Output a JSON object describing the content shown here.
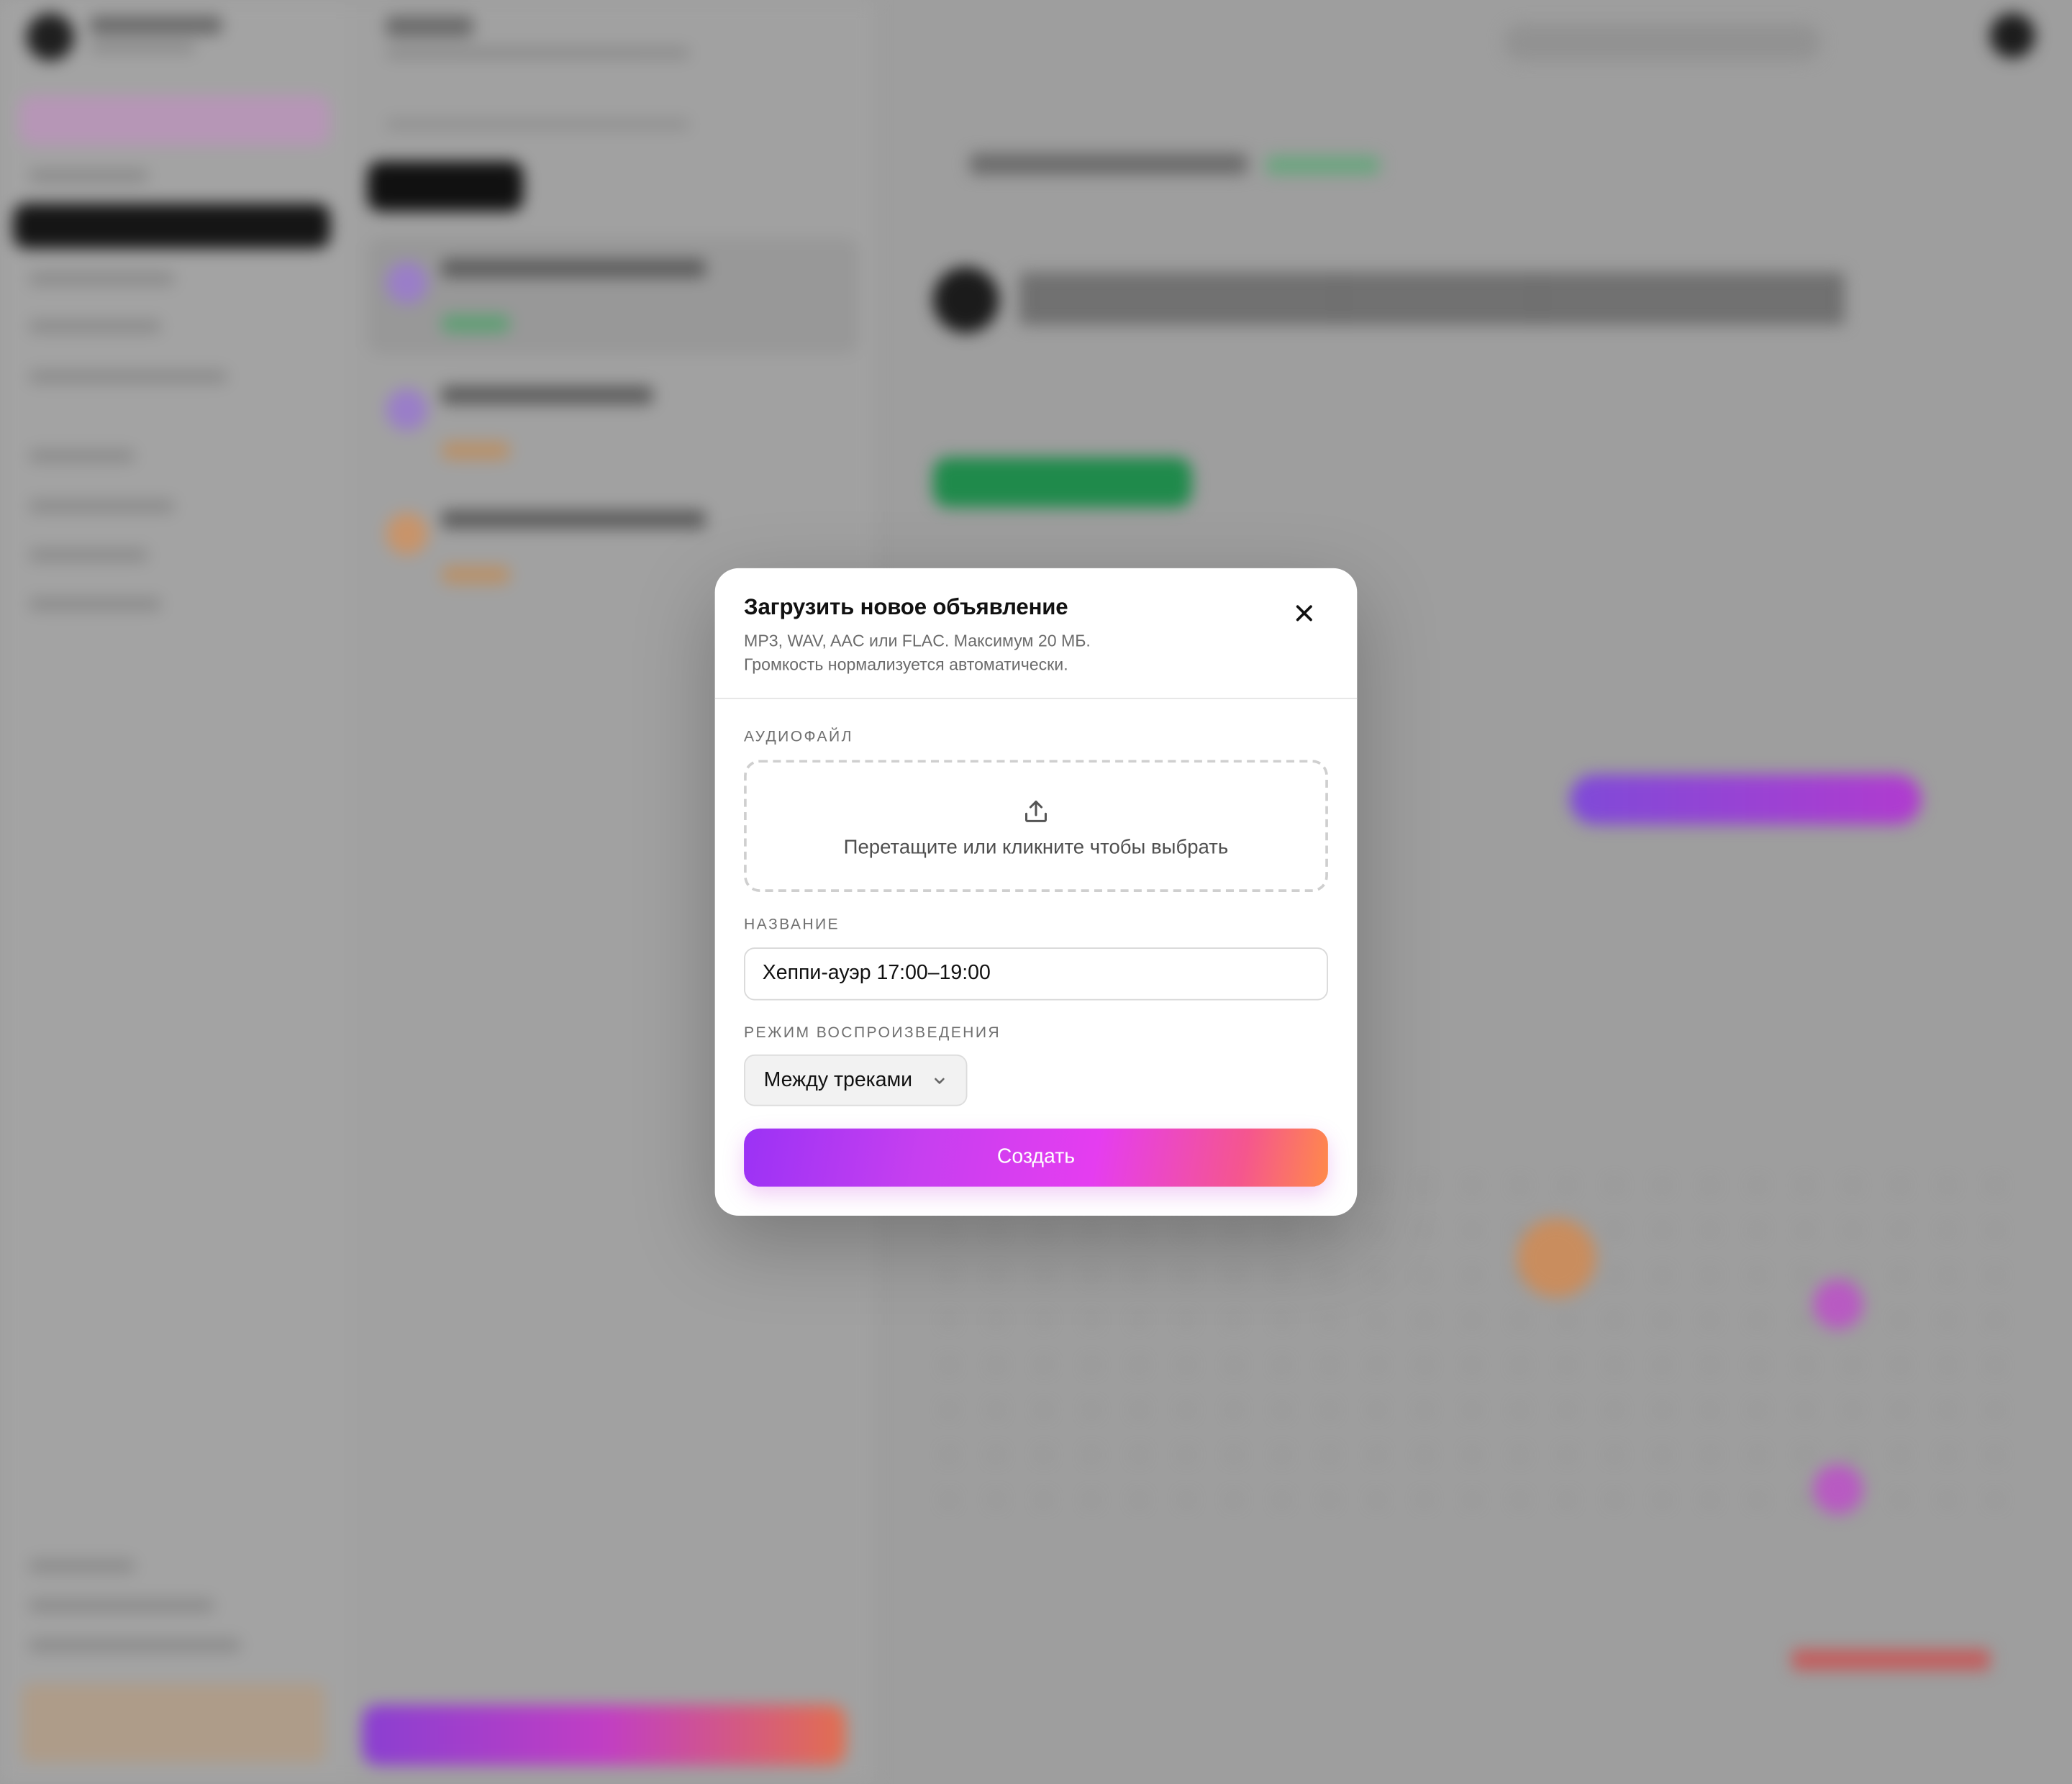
{
  "modal": {
    "title": "Загрузить новое объявление",
    "subtitle_line1": "MP3, WAV, AAC или FLAC. Максимум 20 МБ.",
    "subtitle_line2": "Громкость нормализуется автоматически.",
    "close_icon": "close-icon",
    "audio_section_label": "АУДИОФАЙЛ",
    "dropzone_icon": "upload-icon",
    "dropzone_text": "Перетащите или кликните чтобы выбрать",
    "name_section_label": "НАЗВАНИЕ",
    "name_value": "Хеппи-ауэр 17:00–19:00",
    "mode_section_label": "РЕЖИМ ВОСПРОИЗВЕДЕНИЯ",
    "mode_selected": "Между треками",
    "create_label": "Создать"
  },
  "colors": {
    "overlay": "#9e9e9e",
    "modal_bg": "#ffffff",
    "button_gradient_start": "#9b32f5",
    "button_gradient_mid": "#e53df0",
    "button_gradient_end": "#ff8a4a"
  }
}
